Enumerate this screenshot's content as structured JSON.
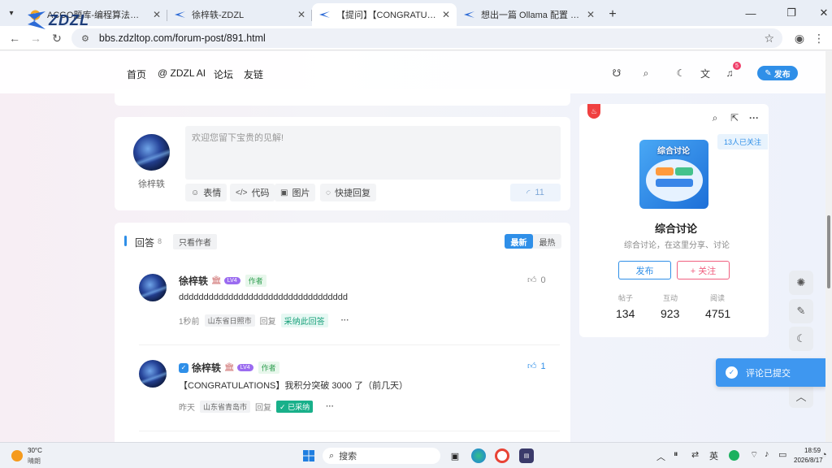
{
  "browser": {
    "tabs": [
      {
        "title": "ACGO题库-编程算法训练_信息学",
        "active": false
      },
      {
        "title": "徐梓轶-ZDZL",
        "active": false
      },
      {
        "title": "【提问】【CONGRATULATIONS】",
        "active": true
      },
      {
        "title": "想出一篇 Ollama 配置 AI 教程-稀",
        "active": false
      }
    ],
    "url": "bbs.zdzltop.com/forum-post/891.html"
  },
  "site": {
    "logo": "ZDZL",
    "nav": [
      "首页",
      "@ ZDZL AI",
      "论坛",
      "友链"
    ],
    "notif_count": "5",
    "publish": "发布"
  },
  "comment_box": {
    "username": "徐梓轶",
    "placeholder": "欢迎您留下宝贵的见解!",
    "buttons": [
      "表情",
      "代码",
      "图片",
      "快捷回复"
    ],
    "count": "11"
  },
  "answers": {
    "title": "回答",
    "count": "8",
    "author_only": "只看作者",
    "sort": [
      "最新",
      "最热"
    ],
    "items": [
      {
        "name": "徐梓轶",
        "level": "LV4",
        "role": "作者",
        "content": "dddddddddddddddddddddddddddddddddd",
        "time": "1秒前",
        "location": "山东省日照市",
        "reply": "回复",
        "accept": "采纳此回答",
        "likes": "0"
      },
      {
        "name": "徐梓轶",
        "level": "LV4",
        "role": "作者",
        "content": "【CONGRATULATIONS】我积分突破 3000 了（前几天）",
        "time": "昨天",
        "location": "山东省青岛市",
        "reply": "回复",
        "accepted": "已采纳",
        "likes": "1"
      }
    ]
  },
  "forum_card": {
    "followers": "13人已关注",
    "image_text": "综合讨论",
    "name": "综合讨论",
    "desc": "综合讨论，在这里分享、讨论",
    "publish": "发布",
    "follow": "+ 关注",
    "stats": [
      {
        "label": "帖子",
        "value": "134"
      },
      {
        "label": "互动",
        "value": "923"
      },
      {
        "label": "阅读",
        "value": "4751"
      }
    ]
  },
  "toast": "评论已提交",
  "taskbar": {
    "temp": "30°C",
    "weather": "晴朗",
    "search": "搜索",
    "ime": "英",
    "time": "18:59",
    "date": "2026/8/17"
  }
}
